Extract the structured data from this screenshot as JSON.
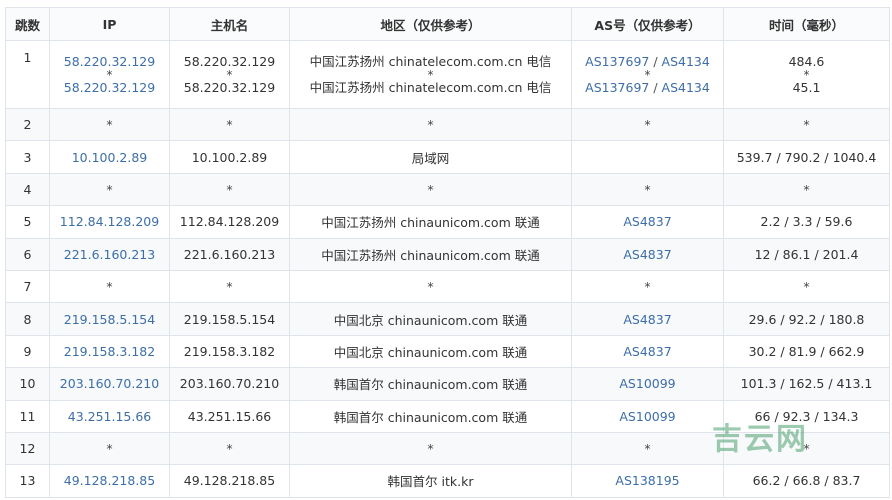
{
  "headers": {
    "hop": "跳数",
    "ip": "IP",
    "host": "主机名",
    "region": "地区（仅供参考）",
    "as": "AS号（仅供参考）",
    "time": "时间（毫秒）"
  },
  "separator": "*",
  "rows": [
    {
      "hop": "1",
      "ip_a": "58.220.32.129",
      "ip_b": "58.220.32.129",
      "host_a": "58.220.32.129",
      "host_b": "58.220.32.129",
      "region_a": "中国江苏扬州 chinatelecom.com.cn 电信",
      "region_b": "中国江苏扬州 chinatelecom.com.cn 电信",
      "as_a1": "AS137697",
      "as_a2": "AS4134",
      "as_b1": "AS137697",
      "as_b2": "AS4134",
      "time_a": "484.6",
      "time_b": "45.1"
    },
    {
      "hop": "2",
      "ip": "*",
      "host": "*",
      "region": "*",
      "as": "*",
      "time": "*"
    },
    {
      "hop": "3",
      "ip": "10.100.2.89",
      "host": "10.100.2.89",
      "region": "局域网",
      "as": "",
      "time": "539.7 / 790.2 / 1040.4"
    },
    {
      "hop": "4",
      "ip": "*",
      "host": "*",
      "region": "*",
      "as": "*",
      "time": "*"
    },
    {
      "hop": "5",
      "ip": "112.84.128.209",
      "host": "112.84.128.209",
      "region": "中国江苏扬州 chinaunicom.com 联通",
      "as": "AS4837",
      "time": "2.2 / 3.3 / 59.6"
    },
    {
      "hop": "6",
      "ip": "221.6.160.213",
      "host": "221.6.160.213",
      "region": "中国江苏扬州 chinaunicom.com 联通",
      "as": "AS4837",
      "time": "12 / 86.1 / 201.4"
    },
    {
      "hop": "7",
      "ip": "*",
      "host": "*",
      "region": "*",
      "as": "*",
      "time": "*"
    },
    {
      "hop": "8",
      "ip": "219.158.5.154",
      "host": "219.158.5.154",
      "region": "中国北京 chinaunicom.com 联通",
      "as": "AS4837",
      "time": "29.6 / 92.2 / 180.8"
    },
    {
      "hop": "9",
      "ip": "219.158.3.182",
      "host": "219.158.3.182",
      "region": "中国北京 chinaunicom.com 联通",
      "as": "AS4837",
      "time": "30.2 / 81.9 / 662.9"
    },
    {
      "hop": "10",
      "ip": "203.160.70.210",
      "host": "203.160.70.210",
      "region": "韩国首尔 chinaunicom.com 联通",
      "as": "AS10099",
      "time": "101.3 / 162.5 / 413.1"
    },
    {
      "hop": "11",
      "ip": "43.251.15.66",
      "host": "43.251.15.66",
      "region": "韩国首尔 chinaunicom.com 联通",
      "as": "AS10099",
      "time": "66 / 92.3 / 134.3"
    },
    {
      "hop": "12",
      "ip": "*",
      "host": "*",
      "region": "*",
      "as": "*",
      "time": "*"
    },
    {
      "hop": "13",
      "ip": "49.128.218.85",
      "host": "49.128.218.85",
      "region": "韩国首尔 itk.kr",
      "as": "AS138195",
      "time": "66.2 / 66.8 / 83.7"
    }
  ],
  "watermark": "吉云网",
  "colors": {
    "link": "#3d6ea8",
    "border": "#dfe4ea",
    "stripe": "#f7f9fb",
    "watermark": "#4ca06e"
  }
}
